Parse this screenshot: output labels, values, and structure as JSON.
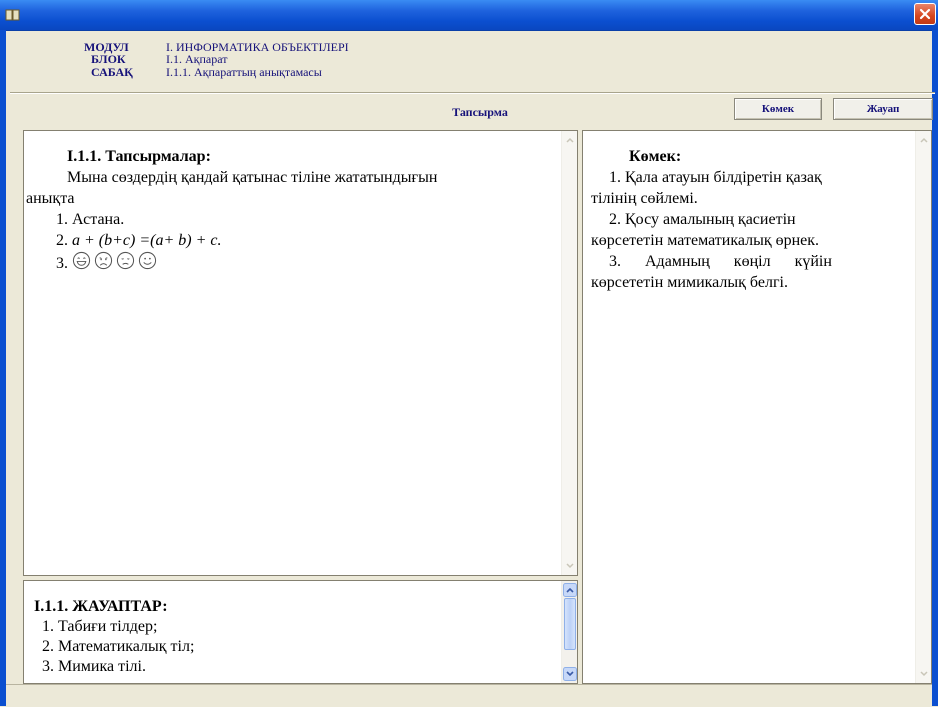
{
  "header": {
    "module_key": "МОДУЛ",
    "module_val": "I. ИНФОРМАТИКА ОБЪЕКТІЛЕРІ",
    "block_key": "БЛОК",
    "block_val": "I.1. Ақпарат",
    "lesson_key": "САБАҚ",
    "lesson_val": "I.1.1. Ақпараттың анықтамасы"
  },
  "toolbar": {
    "tab_label": "Тапсырма",
    "help_button": "Көмек",
    "answer_button": "Жауап"
  },
  "task": {
    "title": "I.1.1. Тапсырмалар:",
    "line1": "Мына сөздердің қандай қатынас тіліне жататындығын",
    "line2": "анықта",
    "item1": "1. Астана.",
    "item2_prefix": "2. ",
    "item2_formula": "a + (b+c) =(a+ b) + c.",
    "item3_prefix": "3. "
  },
  "help": {
    "title": "Көмек:",
    "line1": "1.  Қала атауын білдіретін қазақ",
    "line2": "тілінің сөйлемі.",
    "line3": "2.   Қосу   амалының   қасиетін",
    "line4": "көрсететін математикалық өрнек.",
    "line5": "3.      Адамның      көңіл      күйін",
    "line6": "көрсететін мимикалық белгі."
  },
  "answers": {
    "title": "I.1.1. ЖАУАПТАР:",
    "items": [
      "1.     Табиғи тілдер;",
      "2.      Математикалық тіл;",
      "3.      Мимика тілі."
    ]
  }
}
